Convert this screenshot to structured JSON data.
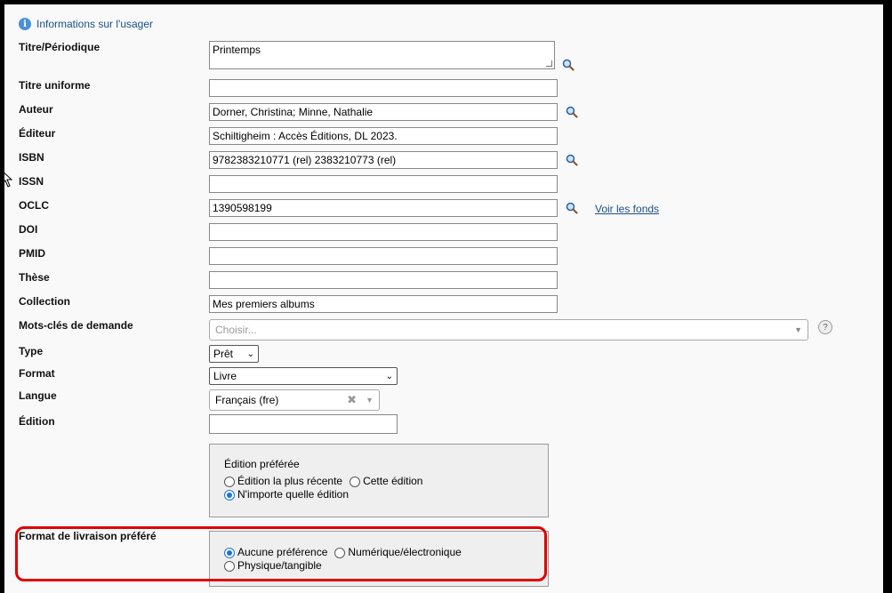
{
  "header": {
    "info_link": "Informations sur l'usager"
  },
  "fields": {
    "titre_label": "Titre/Périodique",
    "titre_value": "Printemps",
    "titre_uniforme_label": "Titre uniforme",
    "titre_uniforme_value": "",
    "auteur_label": "Auteur",
    "auteur_value": "Dorner, Christina; Minne, Nathalie",
    "editeur_label": "Éditeur",
    "editeur_value": "Schiltigheim : Accès Éditions, DL 2023.",
    "isbn_label": "ISBN",
    "isbn_value": "9782383210771 (rel)  2383210773 (rel)",
    "issn_label": "ISSN",
    "issn_value": "",
    "oclc_label": "OCLC",
    "oclc_value": "1390598199",
    "voir_fonds": "Voir les fonds",
    "doi_label": "DOI",
    "doi_value": "",
    "pmid_label": "PMID",
    "pmid_value": "",
    "these_label": "Thèse",
    "these_value": "",
    "collection_label": "Collection",
    "collection_value": "Mes premiers albums",
    "mots_cles_label": "Mots-clés de demande",
    "mots_cles_placeholder": "Choisir...",
    "type_label": "Type",
    "type_value": "Prêt",
    "format_label": "Format",
    "format_value": "Livre",
    "langue_label": "Langue",
    "langue_value": "Français (fre)",
    "edition_label": "Édition",
    "edition_value": ""
  },
  "edition_pref": {
    "title": "Édition préférée",
    "options": [
      "Édition la plus récente",
      "Cette édition",
      "N'importe quelle édition"
    ],
    "selected": 2
  },
  "livraison": {
    "label": "Format de livraison préféré",
    "options": [
      "Aucune préférence",
      "Numérique/électronique",
      "Physique/tangible"
    ],
    "selected": 0
  },
  "colors": {
    "accent": "#1a73e8",
    "highlight": "#e00000",
    "link": "#1a4f8b"
  }
}
